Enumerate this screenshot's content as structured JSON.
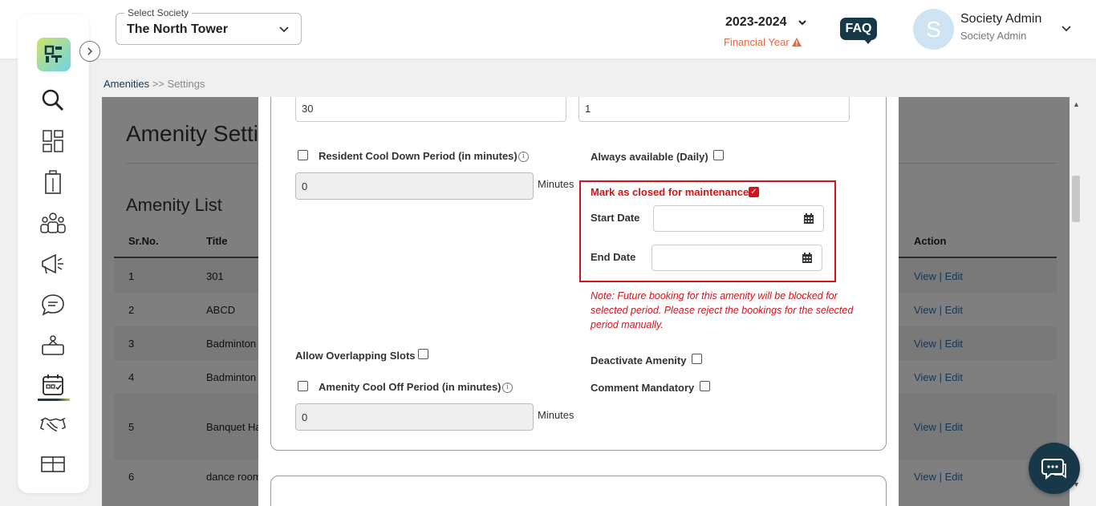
{
  "header": {
    "society_label": "Select Society",
    "society_value": "The North Tower",
    "financial_year_value": "2023-2024",
    "financial_year_label": "Financial Year",
    "faq_label": "FAQ",
    "avatar_letter": "S",
    "user_name": "Society Admin",
    "user_role": "Society Admin"
  },
  "breadcrumb": {
    "link": "Amenities",
    "separator": ">>",
    "current": "Settings"
  },
  "sidebar": {
    "icons": [
      "search-icon",
      "dashboard-icon",
      "building-icon",
      "residents-icon",
      "announcement-icon",
      "chat-icon",
      "facility-icon",
      "calendar-icon",
      "handshake-icon",
      "storage-icon"
    ],
    "active": "calendar-icon"
  },
  "background_page": {
    "title": "Amenity Setti",
    "list_title": "Amenity List",
    "columns": [
      "Sr.No.",
      "Title",
      "Action"
    ],
    "rows": [
      {
        "sr": "1",
        "title": "301",
        "view": "View",
        "edit": "Edit"
      },
      {
        "sr": "2",
        "title": "ABCD",
        "view": "View",
        "edit": "Edit"
      },
      {
        "sr": "3",
        "title": "Badminton",
        "view": "View",
        "edit": "Edit"
      },
      {
        "sr": "4",
        "title": "Badminton",
        "view": "View",
        "edit": "Edit"
      },
      {
        "sr": "5",
        "title": "Banquet Ha",
        "view": "View",
        "edit": "Edit"
      },
      {
        "sr": "6",
        "title": "dance room",
        "view": "View",
        "edit": "Edit"
      }
    ],
    "action_separator": "|"
  },
  "modal": {
    "field_top_left_value": "30",
    "field_top_right_value": "1",
    "resident_cooldown_label": "Resident Cool Down Period (in minutes)",
    "resident_cooldown_value": "0",
    "minutes_unit": "Minutes",
    "always_available_label": "Always available (Daily)",
    "maintenance_label": "Mark as closed for maintenance",
    "start_date_label": "Start Date",
    "start_date_value": "",
    "end_date_label": "End Date",
    "end_date_value": "",
    "maintenance_note": "Note: Future booking for this amenity will be blocked for selected period. Please reject the bookings for the selected period manually.",
    "allow_overlap_label": "Allow Overlapping Slots",
    "deactivate_label": "Deactivate Amenity",
    "cooloff_label": "Amenity Cool Off Period (in minutes)",
    "cooloff_value": "0",
    "comment_mandatory_label": "Comment Mandatory",
    "info_glyph": "i",
    "check_glyph": "✓"
  },
  "colors": {
    "brand_dark": "#173848",
    "alert_red": "#d3141b",
    "financial_year_orange": "#e5673a",
    "link_blue": "#2a6fb0"
  }
}
